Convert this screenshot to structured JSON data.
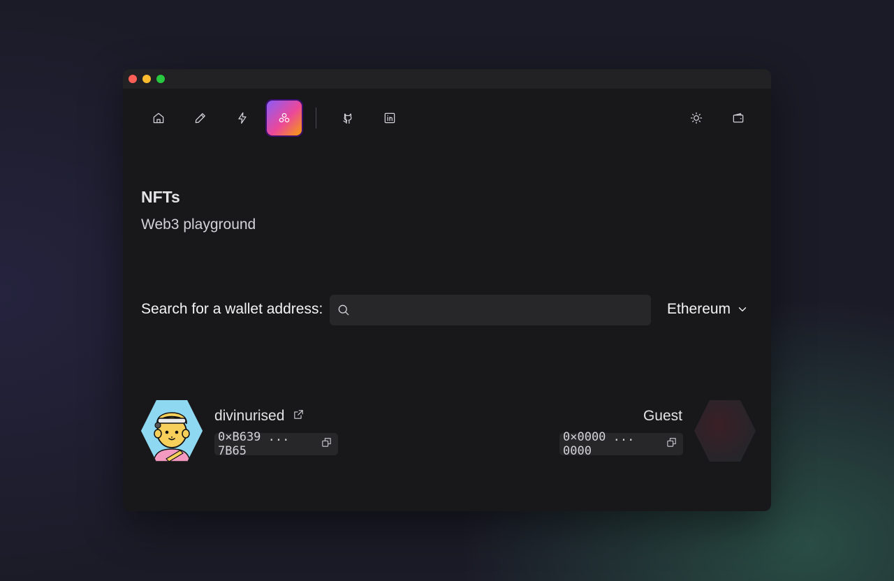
{
  "window": {
    "controls": [
      "close",
      "minimize",
      "maximize"
    ]
  },
  "nav": {
    "items": [
      {
        "icon": "home-icon",
        "active": false
      },
      {
        "icon": "pencil-icon",
        "active": false
      },
      {
        "icon": "lightning-icon",
        "active": false
      },
      {
        "icon": "nft-circles-icon",
        "active": true
      },
      {
        "icon": "github-icon",
        "active": false
      },
      {
        "icon": "linkedin-icon",
        "active": false
      },
      {
        "icon": "sun-icon",
        "active": false
      },
      {
        "icon": "wallet-icon",
        "active": false
      }
    ],
    "active_gradient": [
      "#8b5cf6",
      "#ec4899",
      "#f59e0b"
    ]
  },
  "page": {
    "title": "NFTs",
    "subtitle": "Web3 playground"
  },
  "search": {
    "label": "Search for a wallet address:",
    "placeholder": "",
    "value": ""
  },
  "network": {
    "selected": "Ethereum"
  },
  "users": {
    "left": {
      "name": "divinurised",
      "address": "0×B639 ... 7B65"
    },
    "right": {
      "name": "Guest",
      "address": "0×0000 ... 0000"
    }
  },
  "colors": {
    "background": "#1b1b27",
    "window": "#18181b",
    "field": "#27272a",
    "avatar_bg": "#8ed8f2"
  }
}
